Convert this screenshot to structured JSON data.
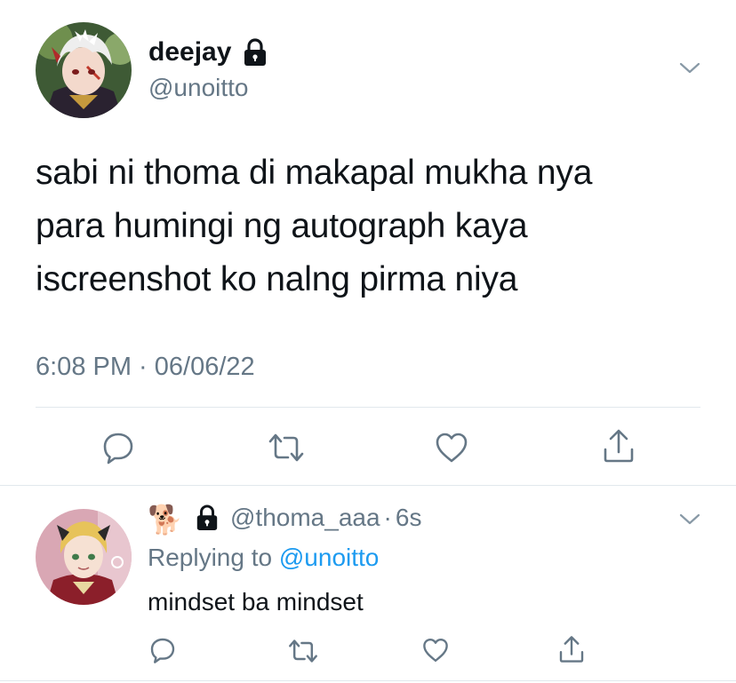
{
  "tweet": {
    "display_name": "deejay",
    "handle": "@unoitto",
    "text_lines": [
      "sabi ni thoma di makapal mukha nya",
      "para humingi ng autograph kaya",
      "iscreenshot ko nalng pirma niya"
    ],
    "timestamp": "6:08 PM · 06/06/22",
    "locked": true
  },
  "reply": {
    "display_name_emoji": "🐕",
    "handle": "@thoma_aaa",
    "separator": "·",
    "age": "6s",
    "replying_prefix": "Replying to",
    "replying_to": "@unoitto",
    "text": "mindset ba mindset",
    "locked": true
  },
  "colors": {
    "text": "#0f1419",
    "secondary": "#657786",
    "link": "#1d9bf0",
    "divider": "#e1e8ed"
  },
  "icons": {
    "actions": [
      "reply-icon",
      "retweet-icon",
      "like-icon",
      "share-icon"
    ],
    "menu": "chevron-down-icon",
    "lock": "lock-icon"
  }
}
